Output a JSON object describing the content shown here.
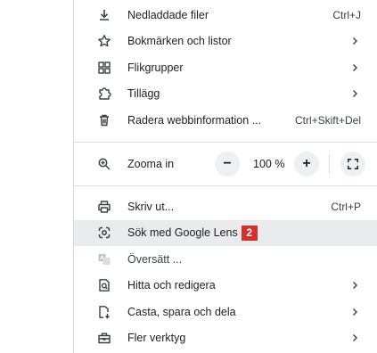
{
  "menu": {
    "group1": [
      {
        "label": "Nedladdade filer",
        "shortcut": "Ctrl+J",
        "icon": "download-icon"
      },
      {
        "label": "Bokmärken och listor",
        "icon": "star-icon",
        "submenu": true
      },
      {
        "label": "Flikgrupper",
        "icon": "tab-groups-icon",
        "submenu": true
      },
      {
        "label": "Tillägg",
        "icon": "extension-icon",
        "submenu": true
      },
      {
        "label": "Radera webbinformation ...",
        "shortcut": "Ctrl+Skift+Del",
        "icon": "trash-icon"
      }
    ],
    "zoom": {
      "label": "Zooma in",
      "minus": "−",
      "value": "100 %",
      "plus": "+",
      "icon": "zoom-icon"
    },
    "group2": [
      {
        "label": "Skriv ut...",
        "shortcut": "Ctrl+P",
        "icon": "print-icon"
      },
      {
        "label": "Sök med Google Lens",
        "badge": "2",
        "icon": "google-lens-icon",
        "highlighted": true
      },
      {
        "label": "Översätt ...",
        "icon": "translate-icon"
      },
      {
        "label": "Hitta och redigera",
        "icon": "find-icon",
        "submenu": true
      },
      {
        "label": "Casta, spara och dela",
        "icon": "cast-save-icon",
        "submenu": true
      },
      {
        "label": "Fler verktyg",
        "icon": "toolbox-icon",
        "submenu": true
      }
    ]
  }
}
